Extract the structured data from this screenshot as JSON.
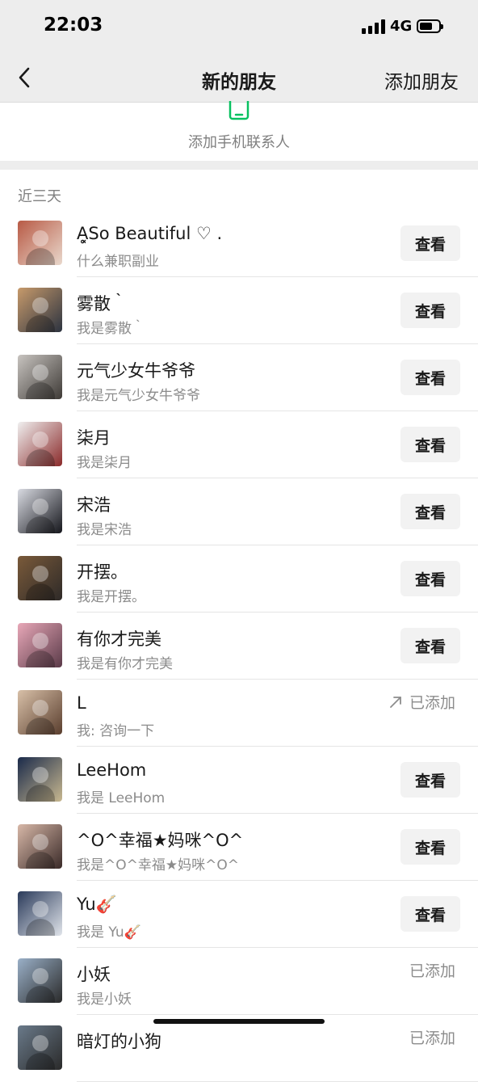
{
  "status": {
    "time": "22:03",
    "network": "4G"
  },
  "nav": {
    "title": "新的朋友",
    "right_action": "添加朋友"
  },
  "add_contacts": {
    "label": "添加手机联系人"
  },
  "section": {
    "label": "近三天"
  },
  "colors": {
    "accent_green": "#07c160",
    "background_gray": "#ededed"
  },
  "requests": [
    {
      "name": "Ḁ͓So Beautiful ♡ .",
      "message": "什么兼职副业",
      "action": "查看",
      "avatar": [
        "#b85a45",
        "#e9d8cc"
      ]
    },
    {
      "name": "雾散｀",
      "message": "我是雾散｀",
      "action": "查看",
      "avatar": [
        "#c79a6b",
        "#2c3340"
      ]
    },
    {
      "name": "元气少女牛爷爷",
      "message": "我是元气少女牛爷爷",
      "action": "查看",
      "avatar": [
        "#c8c4c0",
        "#3e3a36"
      ]
    },
    {
      "name": "柒月",
      "message": "我是柒月",
      "action": "查看",
      "avatar": [
        "#f0f0f0",
        "#8a2a2a"
      ]
    },
    {
      "name": "宋浩",
      "message": "我是宋浩",
      "action": "查看",
      "avatar": [
        "#d9dbe2",
        "#15161c"
      ]
    },
    {
      "name": "开摆。",
      "message": "我是开摆。",
      "action": "查看",
      "avatar": [
        "#7a5a3a",
        "#2e2a28"
      ]
    },
    {
      "name": "有你才完美",
      "message": "我是有你才完美",
      "action": "查看",
      "avatar": [
        "#e8a8b8",
        "#5a3a48"
      ]
    },
    {
      "name": "L",
      "message": "我: 咨询一下",
      "status": "已添加",
      "avatar": [
        "#d8c0a8",
        "#5a3e2e"
      ]
    },
    {
      "name": "LeeHom",
      "message": "我是 LeeHom",
      "action": "查看",
      "avatar": [
        "#1a2a4a",
        "#c8b890"
      ]
    },
    {
      "name": "^O^幸福★妈咪^O^",
      "message": "我是^O^幸福★妈咪^O^",
      "action": "查看",
      "avatar": [
        "#d8b8a8",
        "#3a2a28"
      ]
    },
    {
      "name": "Yu🎸",
      "message": "我是 Yu🎸",
      "action": "查看",
      "avatar": [
        "#2a3a5a",
        "#e0e4ea"
      ]
    },
    {
      "name": "小妖",
      "message": "我是小妖",
      "status": "已添加",
      "avatar": [
        "#9ab0c8",
        "#2a2a2a"
      ]
    },
    {
      "name": "暗灯的小狗",
      "message": "",
      "status": "已添加",
      "avatar": [
        "#6a7a8a",
        "#2a2a2a"
      ]
    }
  ]
}
